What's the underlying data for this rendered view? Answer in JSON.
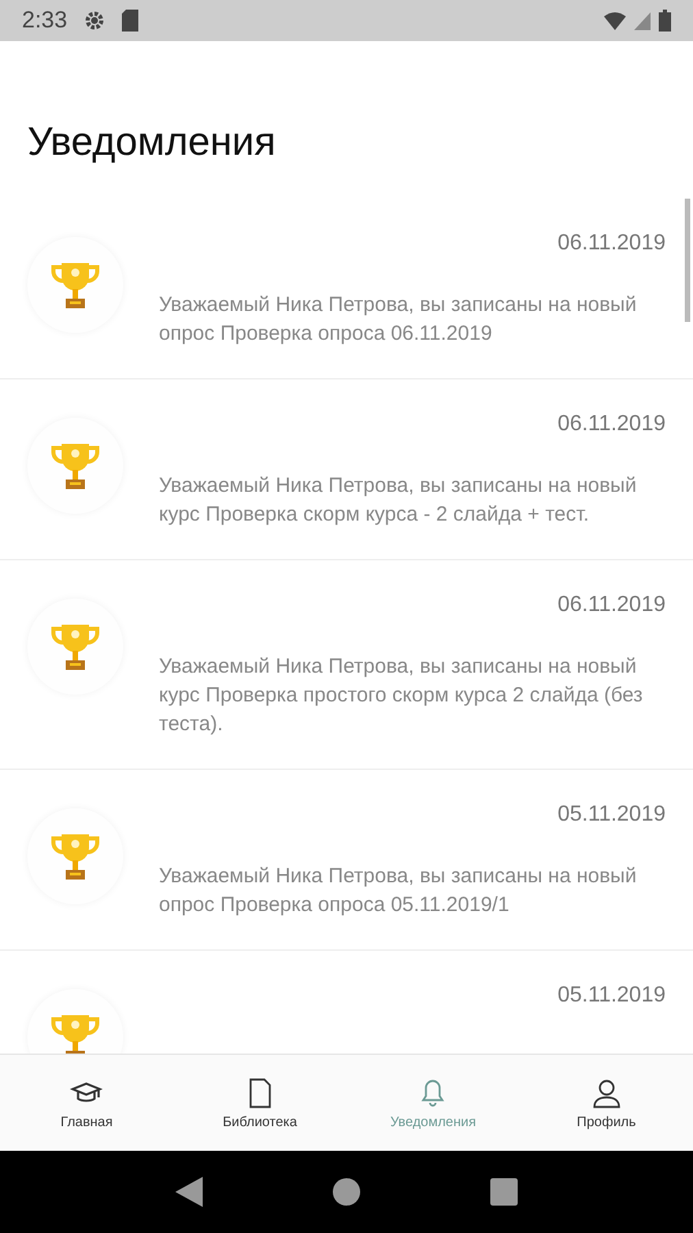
{
  "status_bar": {
    "time": "2:33"
  },
  "header": {
    "title": "Уведомления"
  },
  "notifications": [
    {
      "date": "06.11.2019",
      "text": "Уважаемый Ника Петрова, вы записаны на новый опрос Проверка опроса 06.11.2019"
    },
    {
      "date": "06.11.2019",
      "text": "Уважаемый Ника Петрова, вы записаны на новый курс Проверка скорм курса - 2 слайда + тест."
    },
    {
      "date": "06.11.2019",
      "text": "Уважаемый Ника Петрова, вы записаны на новый курс Проверка простого скорм курса 2 слайда (без теста)."
    },
    {
      "date": "05.11.2019",
      "text": "Уважаемый Ника Петрова, вы записаны на новый опрос Проверка опроса 05.11.2019/1"
    },
    {
      "date": "05.11.2019"
    }
  ],
  "bottom_nav": [
    {
      "kind": "home",
      "label": "Главная",
      "selected": false
    },
    {
      "kind": "library",
      "label": "Библиотека",
      "selected": false
    },
    {
      "kind": "notifications",
      "label": "Уведомления",
      "selected": true
    },
    {
      "kind": "profile",
      "label": "Профиль",
      "selected": false
    }
  ]
}
